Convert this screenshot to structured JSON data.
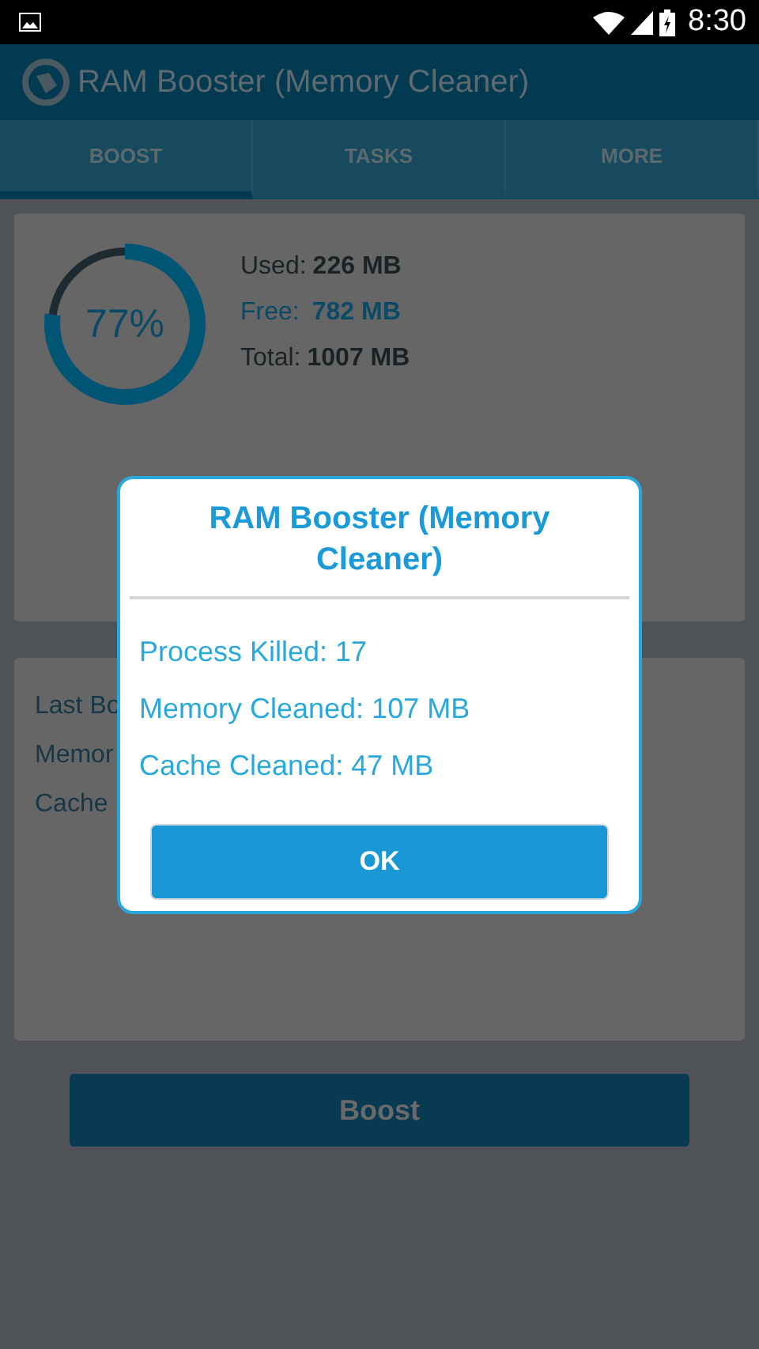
{
  "status_bar": {
    "time": "8:30"
  },
  "app_bar": {
    "title": "RAM Booster (Memory Cleaner)"
  },
  "tabs": [
    {
      "label": "BOOST",
      "selected": true
    },
    {
      "label": "TASKS",
      "selected": false
    },
    {
      "label": "MORE",
      "selected": false
    }
  ],
  "memory": {
    "percent": "77%",
    "level": 0.77,
    "stats": [
      {
        "label": "Used:",
        "value": "226 MB",
        "kind": "plain"
      },
      {
        "label": "Free:",
        "value": "782 MB",
        "kind": "accent"
      },
      {
        "label": "Total:",
        "value": "1007 MB",
        "kind": "plain"
      }
    ]
  },
  "last_boost": {
    "lines": [
      "Last Bo",
      "Memor",
      "Cache"
    ]
  },
  "boost_button": "Boost",
  "dialog": {
    "title": "RAM Booster (Memory Cleaner)",
    "lines": [
      "Process Killed: 17",
      "Memory Cleaned: 107 MB",
      "Cache Cleaned: 47 MB"
    ],
    "button": "OK"
  }
}
